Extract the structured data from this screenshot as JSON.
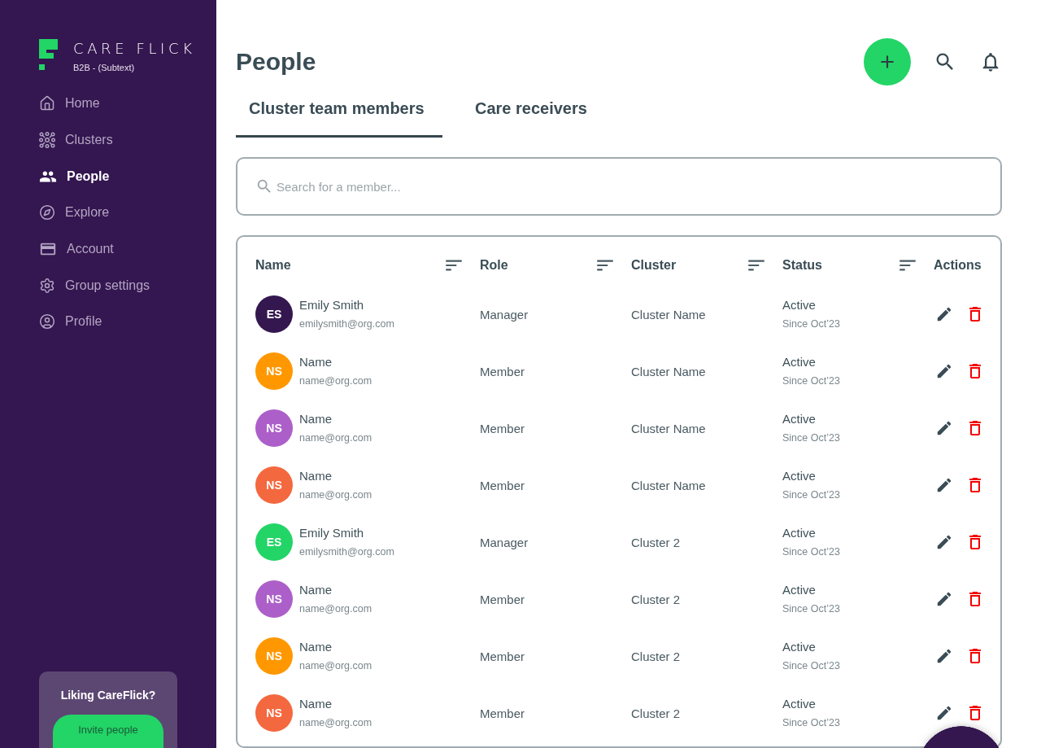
{
  "sidebar": {
    "logo": {
      "name": "CARE FLICK",
      "subtext": "B2B - (Subtext)"
    },
    "items": [
      {
        "label": "Home",
        "selected": false
      },
      {
        "label": "Clusters",
        "selected": false
      },
      {
        "label": "People",
        "selected": true
      },
      {
        "label": "Explore",
        "selected": false
      },
      {
        "label": "Account",
        "selected": false
      },
      {
        "label": "Group settings",
        "selected": false
      },
      {
        "label": "Profile",
        "selected": false
      }
    ],
    "promo": {
      "title": "Liking CareFlick?",
      "button": "Invite people"
    }
  },
  "header": {
    "title": "People"
  },
  "tabs": [
    {
      "label": "Cluster team members",
      "selected": true
    },
    {
      "label": "Care receivers",
      "selected": false
    }
  ],
  "search": {
    "placeholder": "Search for a member..."
  },
  "table": {
    "columns": [
      {
        "label": "Name",
        "sortable": true
      },
      {
        "label": "Role",
        "sortable": true
      },
      {
        "label": "Cluster",
        "sortable": true
      },
      {
        "label": "Status",
        "sortable": true
      },
      {
        "label": "Actions",
        "sortable": false
      }
    ],
    "rows": [
      {
        "initials": "ES",
        "color": "#34174f",
        "name": "Emily Smith",
        "email": "emilysmith@org.com",
        "role": "Manager",
        "cluster": "Cluster Name",
        "status": "Active",
        "since": "Since Oct’23"
      },
      {
        "initials": "NS",
        "color": "#ff9800",
        "name": "Name",
        "email": "name@org.com",
        "role": "Member",
        "cluster": "Cluster Name",
        "status": "Active",
        "since": "Since Oct’23"
      },
      {
        "initials": "NS",
        "color": "#ad5fc9",
        "name": "Name",
        "email": "name@org.com",
        "role": "Member",
        "cluster": "Cluster Name",
        "status": "Active",
        "since": "Since Oct’23"
      },
      {
        "initials": "NS",
        "color": "#f4683f",
        "name": "Name",
        "email": "name@org.com",
        "role": "Member",
        "cluster": "Cluster Name",
        "status": "Active",
        "since": "Since Oct’23"
      },
      {
        "initials": "ES",
        "color": "#22d566",
        "name": "Emily Smith",
        "email": "emilysmith@org.com",
        "role": "Manager",
        "cluster": "Cluster 2",
        "status": "Active",
        "since": "Since Oct’23"
      },
      {
        "initials": "NS",
        "color": "#ad5fc9",
        "name": "Name",
        "email": "name@org.com",
        "role": "Member",
        "cluster": "Cluster 2",
        "status": "Active",
        "since": "Since Oct’23"
      },
      {
        "initials": "NS",
        "color": "#ff9800",
        "name": "Name",
        "email": "name@org.com",
        "role": "Member",
        "cluster": "Cluster 2",
        "status": "Active",
        "since": "Since Oct’23"
      },
      {
        "initials": "NS",
        "color": "#f4683f",
        "name": "Name",
        "email": "name@org.com",
        "role": "Member",
        "cluster": "Cluster 2",
        "status": "Active",
        "since": "Since Oct’23"
      }
    ]
  }
}
